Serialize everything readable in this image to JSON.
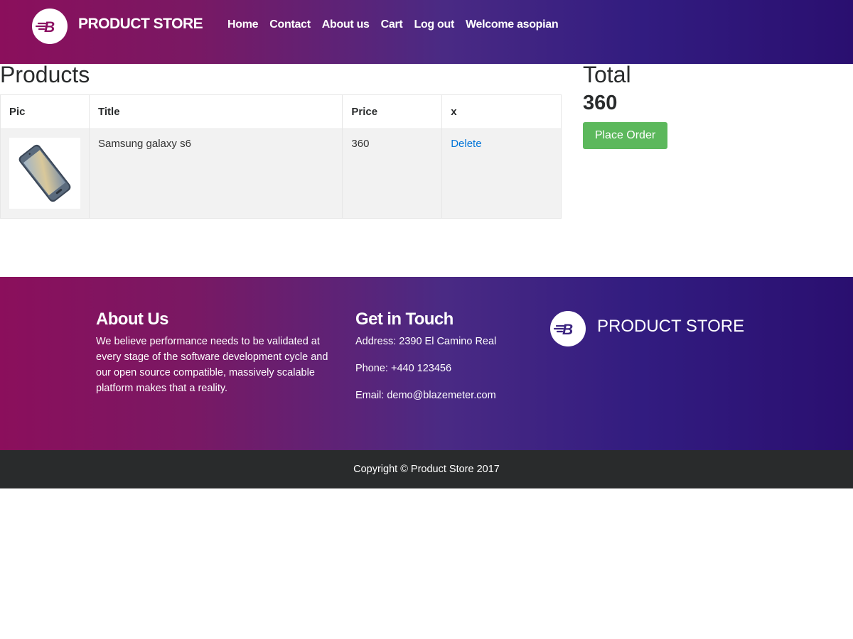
{
  "navbar": {
    "brand": "PRODUCT STORE",
    "logo_letter": "B",
    "links": [
      "Home",
      "Contact",
      "About us",
      "Cart",
      "Log out",
      "Welcome asopian"
    ]
  },
  "products": {
    "title": "Products",
    "columns": [
      "Pic",
      "Title",
      "Price",
      "x"
    ],
    "rows": [
      {
        "pic": "phone-image",
        "title": "Samsung galaxy s6",
        "price": "360",
        "action": "Delete"
      }
    ]
  },
  "total": {
    "title": "Total",
    "value": "360",
    "place_order_label": "Place Order"
  },
  "footer": {
    "about_title": "About Us",
    "about_text": "We believe performance needs to be validated at every stage of the software development cycle and our open source compatible, massively scalable platform makes that a reality.",
    "touch_title": "Get in Touch",
    "address": "Address: 2390 El Camino Real",
    "phone": "Phone: +440 123456",
    "email": "Email: demo@blazemeter.com",
    "brand": "PRODUCT STORE",
    "copyright": "Copyright © Product Store 2017"
  },
  "colors": {
    "gradient_start": "#8b0f5c",
    "gradient_end": "#2a0f70",
    "button_green": "#5cb85c",
    "link_blue": "#0275d8",
    "footer_dark": "#292b2c"
  }
}
